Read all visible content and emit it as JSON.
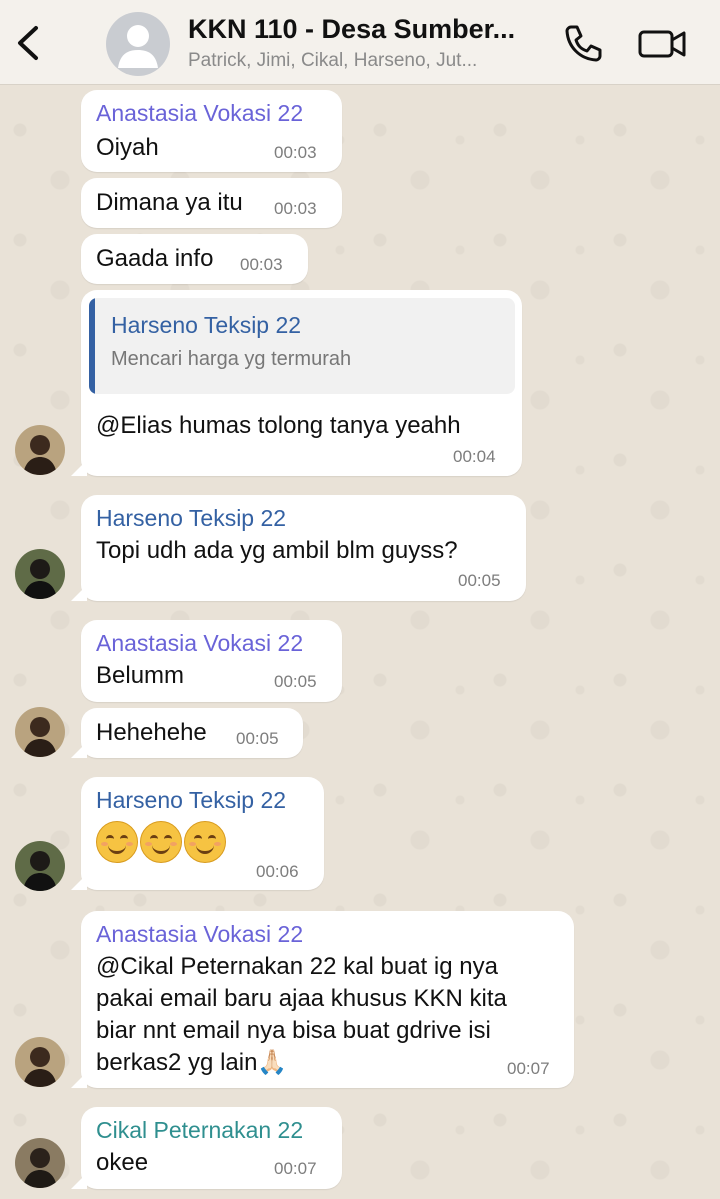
{
  "header": {
    "title": "KKN 110 - Desa Sumber...",
    "subtitle": "Patrick, Jimi, Cikal, Harseno, Jut..."
  },
  "messages": [
    {
      "sender": "Anastasia Vokasi 22",
      "text": "Oiyah",
      "time": "00:03"
    },
    {
      "text": "Dimana ya itu",
      "time": "00:03"
    },
    {
      "text": "Gaada info",
      "time": "00:03"
    },
    {
      "quote": {
        "name": "Harseno Teksip 22",
        "text": "Mencari harga yg termurah"
      },
      "text": "@Elias humas tolong tanya yeahh",
      "time": "00:04"
    },
    {
      "sender": "Harseno Teksip 22",
      "text": "Topi udh ada yg ambil blm guyss?",
      "time": "00:05"
    },
    {
      "sender": "Anastasia Vokasi 22",
      "text": "Belumm",
      "time": "00:05"
    },
    {
      "text": "Hehehehe",
      "time": "00:05"
    },
    {
      "sender": "Harseno Teksip 22",
      "emojis": "😊😊😊",
      "time": "00:06"
    },
    {
      "sender": "Anastasia Vokasi 22",
      "lines": [
        "@Cikal Peternakan 22 kal buat ig nya",
        "pakai email baru ajaa khusus KKN kita",
        "biar nnt email nya bisa buat gdrive isi",
        "berkas2 yg lain🙏🏻"
      ],
      "time": "00:07"
    },
    {
      "sender": "Cikal Peternakan 22",
      "text": "okee",
      "time": "00:07"
    }
  ],
  "colors": {
    "anastasia": "#6a63d8",
    "harseno": "#3461a3",
    "cikal": "#2f8f8f"
  }
}
